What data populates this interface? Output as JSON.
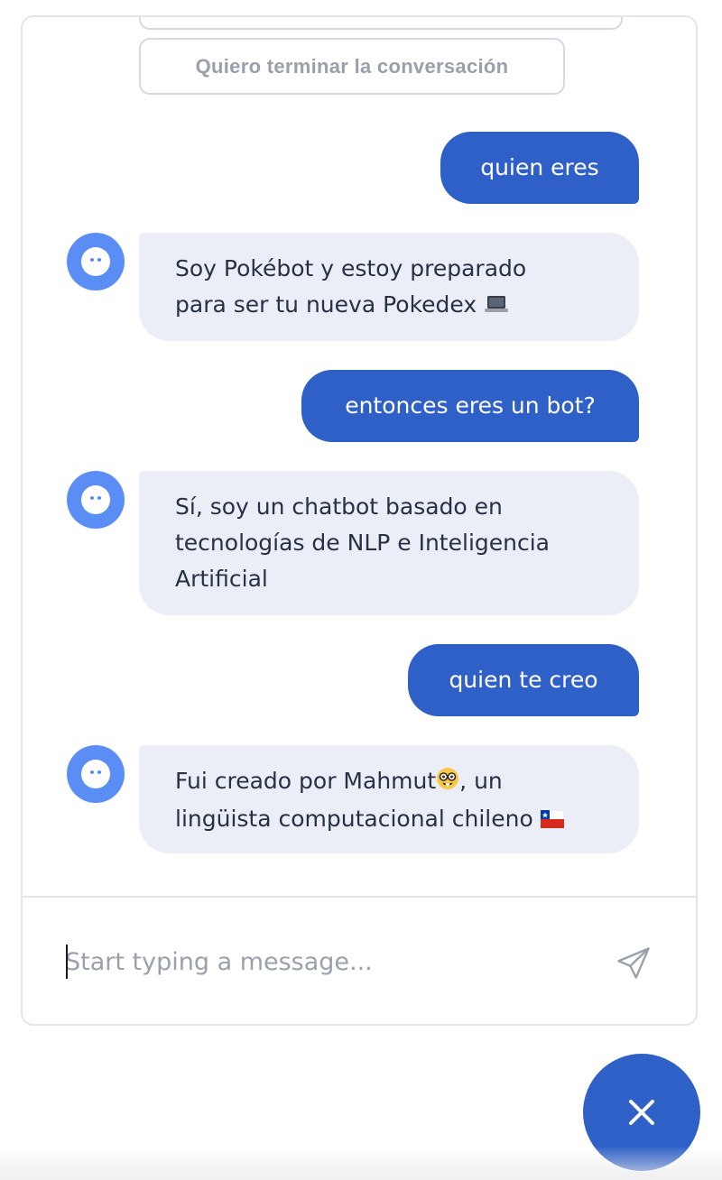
{
  "chat": {
    "option_button_label": "Quiero terminar la conversación",
    "messages": [
      {
        "role": "user",
        "text": "quien eres"
      },
      {
        "role": "bot",
        "line1": "Soy Pokébot y estoy preparado",
        "line2": "para ser tu nueva Pokedex",
        "emoji": "laptop-emoji"
      },
      {
        "role": "user",
        "text": "entonces eres un bot?"
      },
      {
        "role": "bot",
        "line1": "Sí, soy un chatbot basado en",
        "line2": "tecnologías de NLP e Inteligencia",
        "line3": "Artificial"
      },
      {
        "role": "user",
        "text": "quien te creo"
      },
      {
        "role": "bot",
        "line1a": "Fui creado por Mahmut",
        "emoji1": "nerd-face-emoji",
        "line1b": ", un",
        "line2": "lingüista computacional chileno",
        "emoji2": "chile-flag-emoji"
      }
    ]
  },
  "composer": {
    "placeholder": "Start typing a message...",
    "send_icon": "send-paper-plane-icon"
  },
  "launcher": {
    "icon": "close-icon"
  },
  "colors": {
    "accent": "#2f60c8",
    "avatar": "#5b8ef4",
    "bot_bubble": "#eceef7"
  }
}
